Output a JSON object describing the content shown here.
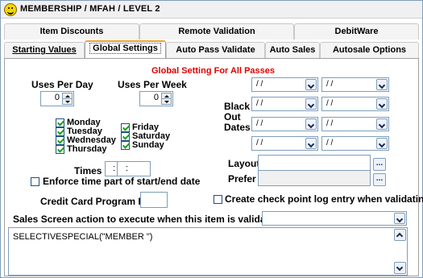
{
  "window": {
    "title": "MEMBERSHIP / MFAH / LEVEL 2",
    "icon": "smiley-icon"
  },
  "tabs_row1": [
    {
      "label": "Item Discounts"
    },
    {
      "label": "Remote Validation"
    },
    {
      "label": "DebitWare"
    }
  ],
  "tabs_row2": [
    {
      "label": "Starting Values"
    },
    {
      "label": "Global Settings",
      "active": true
    },
    {
      "label": "Auto Pass Validate"
    },
    {
      "label": "Auto Sales"
    },
    {
      "label": "Autosale Options"
    }
  ],
  "panel": {
    "heading": "Global Setting For All Passes",
    "uses_per_day_label": "Uses Per Day",
    "uses_per_day_value": "0",
    "uses_per_week_label": "Uses Per Week",
    "uses_per_week_value": "0",
    "days": {
      "monday": "Monday",
      "tuesday": "Tuesday",
      "wednesday": "Wednesday",
      "thursday": "Thursday",
      "friday": "Friday",
      "saturday": "Saturday",
      "sunday": "Sunday"
    },
    "times_label": "Times",
    "time_start": ":",
    "time_end": ":",
    "enforce_time_label": "Enforce time part of start/end date",
    "credit_card_label": "Credit Card Program ID",
    "credit_card_value": "",
    "blackout_label_1": "Black",
    "blackout_label_2": "Out",
    "blackout_label_3": "Dates",
    "blackout_dates": [
      "/ /",
      "/ /",
      "/ /",
      "/ /",
      "/ /",
      "/ /",
      "/ /",
      "/ /"
    ],
    "layout_label": "Layout",
    "layout_value": "",
    "prefer_label": "Prefer",
    "prefer_value": "",
    "ellipsis_label": "...",
    "checkpoint_label": "Create check point log entry when validating",
    "sales_screen_label": "Sales Screen action to execute when this item is validated",
    "sales_screen_value": "",
    "script_text": "SELECTIVESPECIAL(\"MEMBER   \")"
  },
  "colors": {
    "heading_red": "#e00000",
    "active_tab_accent": "#f0a030",
    "checkbox_green": "#20a020",
    "border_blue": "#7f9db9"
  }
}
